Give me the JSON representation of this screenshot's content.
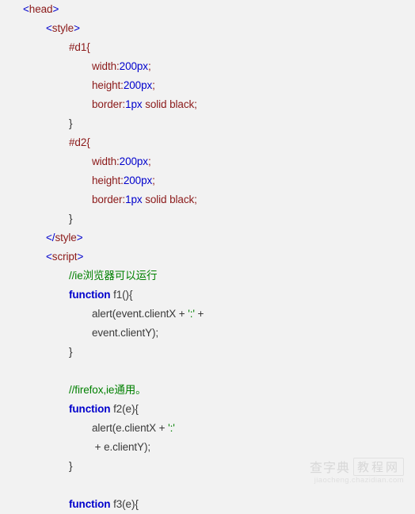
{
  "editor": {
    "background_color": "#f2f2f2",
    "language": "html",
    "colors": {
      "punctuation": "#0000cc",
      "tag": "#8b1a1a",
      "property": "#8b1a1a",
      "value": "#0000cc",
      "keyword": "#0000cc",
      "comment": "#008000",
      "string": "#008000",
      "plain": "#3a3a3a"
    }
  },
  "lines": [
    {
      "indent": 0,
      "tokens": [
        {
          "t": "punct",
          "s": "<"
        },
        {
          "t": "tag",
          "s": "head"
        },
        {
          "t": "punct",
          "s": ">"
        }
      ]
    },
    {
      "indent": 1,
      "tokens": [
        {
          "t": "punct",
          "s": "<"
        },
        {
          "t": "tag",
          "s": "style"
        },
        {
          "t": "punct",
          "s": ">"
        }
      ]
    },
    {
      "indent": 2,
      "tokens": [
        {
          "t": "selector",
          "s": "#d1{"
        }
      ]
    },
    {
      "indent": 3,
      "tokens": [
        {
          "t": "prop",
          "s": "width:"
        },
        {
          "t": "value",
          "s": "200px"
        },
        {
          "t": "prop",
          "s": ";"
        }
      ]
    },
    {
      "indent": 3,
      "tokens": [
        {
          "t": "prop",
          "s": "height:"
        },
        {
          "t": "value",
          "s": "200px"
        },
        {
          "t": "prop",
          "s": ";"
        }
      ]
    },
    {
      "indent": 3,
      "tokens": [
        {
          "t": "prop",
          "s": "border:"
        },
        {
          "t": "value",
          "s": "1px"
        },
        {
          "t": "prop",
          "s": " solid black;"
        }
      ]
    },
    {
      "indent": 2,
      "tokens": [
        {
          "t": "brace",
          "s": "}"
        }
      ]
    },
    {
      "indent": 2,
      "tokens": [
        {
          "t": "selector",
          "s": "#d2{"
        }
      ]
    },
    {
      "indent": 3,
      "tokens": [
        {
          "t": "prop",
          "s": "width:"
        },
        {
          "t": "value",
          "s": "200px"
        },
        {
          "t": "prop",
          "s": ";"
        }
      ]
    },
    {
      "indent": 3,
      "tokens": [
        {
          "t": "prop",
          "s": "height:"
        },
        {
          "t": "value",
          "s": "200px"
        },
        {
          "t": "prop",
          "s": ";"
        }
      ]
    },
    {
      "indent": 3,
      "tokens": [
        {
          "t": "prop",
          "s": "border:"
        },
        {
          "t": "value",
          "s": "1px"
        },
        {
          "t": "prop",
          "s": " solid black;"
        }
      ]
    },
    {
      "indent": 2,
      "tokens": [
        {
          "t": "brace",
          "s": "}"
        }
      ]
    },
    {
      "indent": 1,
      "tokens": [
        {
          "t": "punct",
          "s": "</"
        },
        {
          "t": "tag",
          "s": "style"
        },
        {
          "t": "punct",
          "s": ">"
        }
      ]
    },
    {
      "indent": 1,
      "tokens": [
        {
          "t": "punct",
          "s": "<"
        },
        {
          "t": "tag",
          "s": "script"
        },
        {
          "t": "punct",
          "s": ">"
        }
      ]
    },
    {
      "indent": 2,
      "tokens": [
        {
          "t": "comment",
          "s": "//ie浏览器可以运行"
        }
      ]
    },
    {
      "indent": 2,
      "tokens": [
        {
          "t": "keyword",
          "s": "function"
        },
        {
          "t": "plain",
          "s": " f1(){"
        }
      ]
    },
    {
      "indent": 3,
      "tokens": [
        {
          "t": "plain",
          "s": "alert(event.clientX + "
        },
        {
          "t": "string",
          "s": "':'"
        },
        {
          "t": "plain",
          "s": " +"
        }
      ]
    },
    {
      "indent": 3,
      "tokens": [
        {
          "t": "plain",
          "s": "event.clientY);"
        }
      ]
    },
    {
      "indent": 2,
      "tokens": [
        {
          "t": "brace",
          "s": "}"
        }
      ]
    },
    {
      "indent": 0,
      "tokens": []
    },
    {
      "indent": 2,
      "tokens": [
        {
          "t": "comment",
          "s": "//firefox,ie通用。"
        }
      ]
    },
    {
      "indent": 2,
      "tokens": [
        {
          "t": "keyword",
          "s": "function"
        },
        {
          "t": "plain",
          "s": " f2(e){"
        }
      ]
    },
    {
      "indent": 3,
      "tokens": [
        {
          "t": "plain",
          "s": "alert(e.clientX + "
        },
        {
          "t": "string",
          "s": "':'"
        }
      ]
    },
    {
      "indent": 3,
      "tokens": [
        {
          "t": "plain",
          "s": " + e.clientY);"
        }
      ]
    },
    {
      "indent": 2,
      "tokens": [
        {
          "t": "brace",
          "s": "}"
        }
      ]
    },
    {
      "indent": 0,
      "tokens": []
    },
    {
      "indent": 2,
      "tokens": [
        {
          "t": "keyword",
          "s": "function"
        },
        {
          "t": "plain",
          "s": " f3(e){"
        }
      ]
    }
  ],
  "watermark": {
    "brand": "查字典",
    "boxed": "教程网",
    "url": "jiaocheng.chazidian.com"
  }
}
